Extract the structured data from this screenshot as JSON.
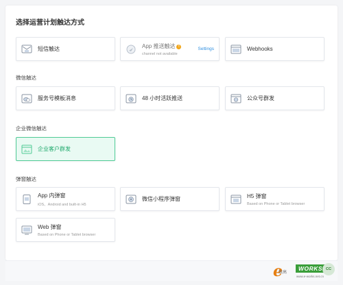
{
  "page": {
    "title": "选择运营计划触达方式"
  },
  "sections": {
    "wechat": "微信触达",
    "work_wechat": "企业微信触达",
    "popup": "弹窗触达"
  },
  "cards": {
    "sms": {
      "label": "短信触达",
      "icon": "sms-icon"
    },
    "app_push": {
      "label": "App 推送触达",
      "sub": "channel not available",
      "warning": "!",
      "settings": "Settings",
      "icon": "push-icon"
    },
    "webhooks": {
      "label": "Webhooks",
      "icon": "webhook-icon"
    },
    "service_template": {
      "label": "服务号模板消息",
      "icon": "wechat-chat-icon"
    },
    "active_push_48h": {
      "label": "48 小时活跃推送",
      "icon": "clock-icon"
    },
    "official_group": {
      "label": "公众号群发",
      "icon": "broadcast-icon"
    },
    "customer_group": {
      "label": "企业客户群发",
      "icon": "group-send-icon"
    },
    "app_popup": {
      "label": "App 内弹窗",
      "sub": "iOS、Android and built-in H5",
      "icon": "phone-popup-icon"
    },
    "miniprogram_popup": {
      "label": "微信小程序弹窗",
      "icon": "miniprogram-icon"
    },
    "h5_popup": {
      "label": "H5 弹窗",
      "sub": "Based on  Phone or Tablet browser",
      "icon": "h5-icon"
    },
    "web_popup": {
      "label": "Web 弹窗",
      "sub": "Based on  Phone or Tablet browser",
      "icon": "web-icon"
    }
  },
  "watermark": {
    "e": "e",
    "cn": "致高",
    "box": "WORKS",
    "cc": "CC",
    "url": "www.e-works.net.cn"
  },
  "colors": {
    "accent_green": "#1fa96c",
    "active_bg": "#e9faf3",
    "link_blue": "#2f8fe0",
    "warning": "#f2a71c"
  }
}
